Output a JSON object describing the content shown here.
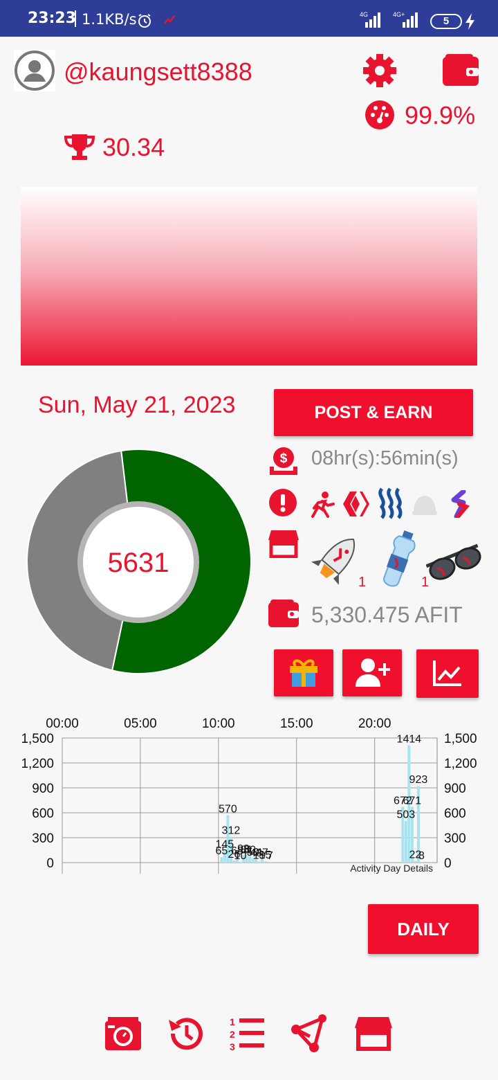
{
  "status_bar": {
    "time": "23:23",
    "speed": "1.1KB/s",
    "network_1": "4G",
    "network_2": "4G+",
    "battery": "5"
  },
  "profile": {
    "username": "@kaungsett8388",
    "rank_score": "30.34",
    "efficiency": "99.9%"
  },
  "activity": {
    "date": "Sun, May 21, 2023",
    "steps": "5631",
    "post_button": "POST & EARN",
    "reward_timer": "08hr(s):56min(s)",
    "balance": "5,330.475 AFIT",
    "boost_counts": [
      "1",
      "1"
    ],
    "daily_button": "DAILY"
  },
  "colors": {
    "accent": "#e8132f",
    "statusbar": "#2e3d97",
    "progress_done": "#006400",
    "progress_remaining": "#808080",
    "bar": "#a8e4ef"
  },
  "icons": {
    "header": [
      "gear-icon",
      "wallet-icon",
      "gauge-icon",
      "trophy-icon",
      "avatar-icon"
    ],
    "side": [
      "money-icon",
      "alert-icon",
      "store-icon",
      "wallet-icon"
    ],
    "tokens": [
      "actifit-icon",
      "hive-icon",
      "steem-icon",
      "blurt-icon",
      "sports-icon"
    ],
    "boosts": [
      "rocket-icon",
      "water-bottle-icon",
      "sunglasses-icon"
    ],
    "actions": [
      "gift-icon",
      "add-friend-icon",
      "chart-icon"
    ],
    "bottom_nav": [
      "camera-icon",
      "history-icon",
      "list-icon",
      "share-icon",
      "store-icon"
    ]
  },
  "chart_data": {
    "type": "bar",
    "title": "Activity Day Details",
    "x_ticks": [
      "00:00",
      "05:00",
      "10:00",
      "15:00",
      "20:00"
    ],
    "y_ticks": [
      "0",
      "300",
      "600",
      "900",
      "1,200",
      "1,500"
    ],
    "ylim": [
      0,
      1500
    ],
    "xlim": [
      0,
      24
    ],
    "points": [
      {
        "x": 10.2,
        "y": 65
      },
      {
        "x": 10.4,
        "y": 145
      },
      {
        "x": 10.6,
        "y": 570
      },
      {
        "x": 10.8,
        "y": 312
      },
      {
        "x": 11.0,
        "y": 26
      },
      {
        "x": 11.2,
        "y": 68
      },
      {
        "x": 11.4,
        "y": 10
      },
      {
        "x": 11.6,
        "y": 93
      },
      {
        "x": 11.8,
        "y": 81
      },
      {
        "x": 12.0,
        "y": 80
      },
      {
        "x": 12.2,
        "y": 50
      },
      {
        "x": 12.4,
        "y": 43
      },
      {
        "x": 12.6,
        "y": 13
      },
      {
        "x": 12.8,
        "y": 47
      },
      {
        "x": 13.0,
        "y": 15
      },
      {
        "x": 13.3,
        "y": 7
      },
      {
        "x": 21.8,
        "y": 672
      },
      {
        "x": 22.0,
        "y": 503
      },
      {
        "x": 22.2,
        "y": 1414
      },
      {
        "x": 22.4,
        "y": 671
      },
      {
        "x": 22.6,
        "y": 22
      },
      {
        "x": 22.8,
        "y": 923
      },
      {
        "x": 23.0,
        "y": 8
      }
    ]
  }
}
